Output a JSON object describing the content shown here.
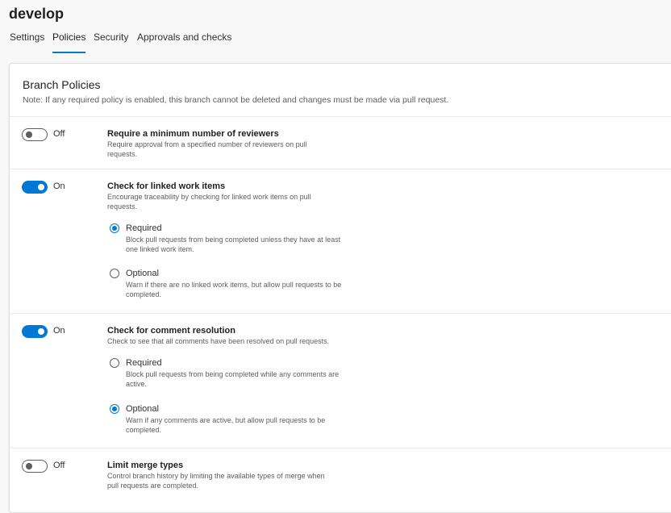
{
  "page": {
    "title": "develop"
  },
  "tabs": [
    {
      "label": "Settings"
    },
    {
      "label": "Policies",
      "active": true
    },
    {
      "label": "Security"
    },
    {
      "label": "Approvals and checks"
    }
  ],
  "card": {
    "title": "Branch Policies",
    "note": "Note: If any required policy is enabled, this branch cannot be deleted and changes must be made via pull request."
  },
  "colors": {
    "accent": "#0078d4",
    "text": "#323130",
    "muted": "#605e5c"
  },
  "policies": [
    {
      "state": "Off",
      "enabled": false,
      "title": "Require a minimum number of reviewers",
      "description": "Require approval from a specified number of reviewers on pull requests."
    },
    {
      "state": "On",
      "enabled": true,
      "title": "Check for linked work items",
      "description": "Encourage traceability by checking for linked work items on pull requests.",
      "options": [
        {
          "label": "Required",
          "selected": true,
          "description": "Block pull requests from being completed unless they have at least one linked work item."
        },
        {
          "label": "Optional",
          "selected": false,
          "description": "Warn if there are no linked work items, but allow pull requests to be completed."
        }
      ]
    },
    {
      "state": "On",
      "enabled": true,
      "title": "Check for comment resolution",
      "description": "Check to see that all comments have been resolved on pull requests.",
      "options": [
        {
          "label": "Required",
          "selected": false,
          "description": "Block pull requests from being completed while any comments are active."
        },
        {
          "label": "Optional",
          "selected": true,
          "description": "Warn if any comments are active, but allow pull requests to be completed."
        }
      ]
    },
    {
      "state": "Off",
      "enabled": false,
      "title": "Limit merge types",
      "description": "Control branch history by limiting the available types of merge when pull requests are completed."
    }
  ]
}
